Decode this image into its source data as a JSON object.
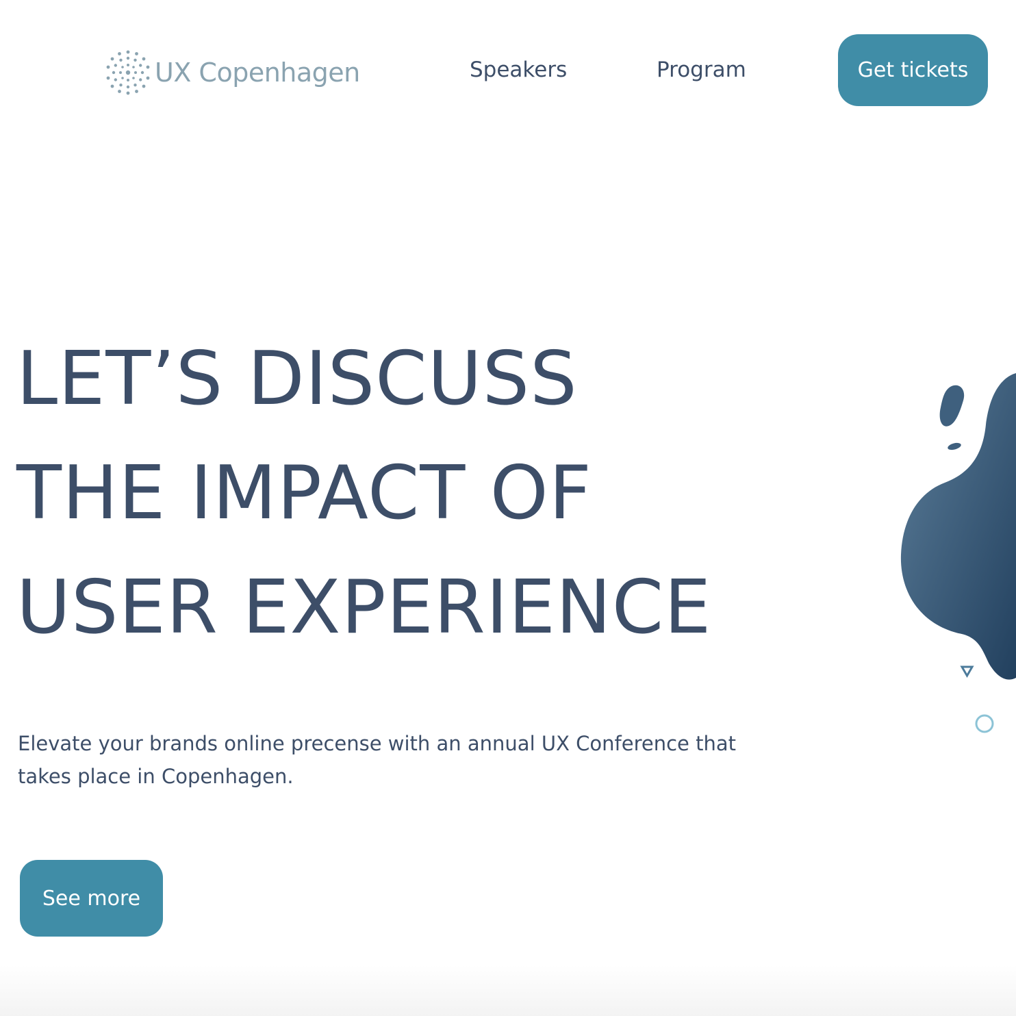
{
  "header": {
    "logo_text": "UX Copenhagen",
    "logo_icon": "dotted-circle-logo-icon",
    "nav": {
      "speakers_label": "Speakers",
      "program_label": "Program"
    },
    "tickets_label": "Get tickets"
  },
  "hero": {
    "title_lines": [
      "LET’S DISCUSS",
      "THE IMPACT OF",
      "USER EXPERIENCE"
    ],
    "subtitle": "Elevate your brands online precense with an annual UX Conference that takes place in Copenhagen.",
    "cta_label": "See more"
  },
  "colors": {
    "accent": "#408da7",
    "text": "#3d4e68",
    "logo_text": "#8aa3b0",
    "blob_dark": "#2c4a66",
    "blob_light": "#5b7d99"
  }
}
